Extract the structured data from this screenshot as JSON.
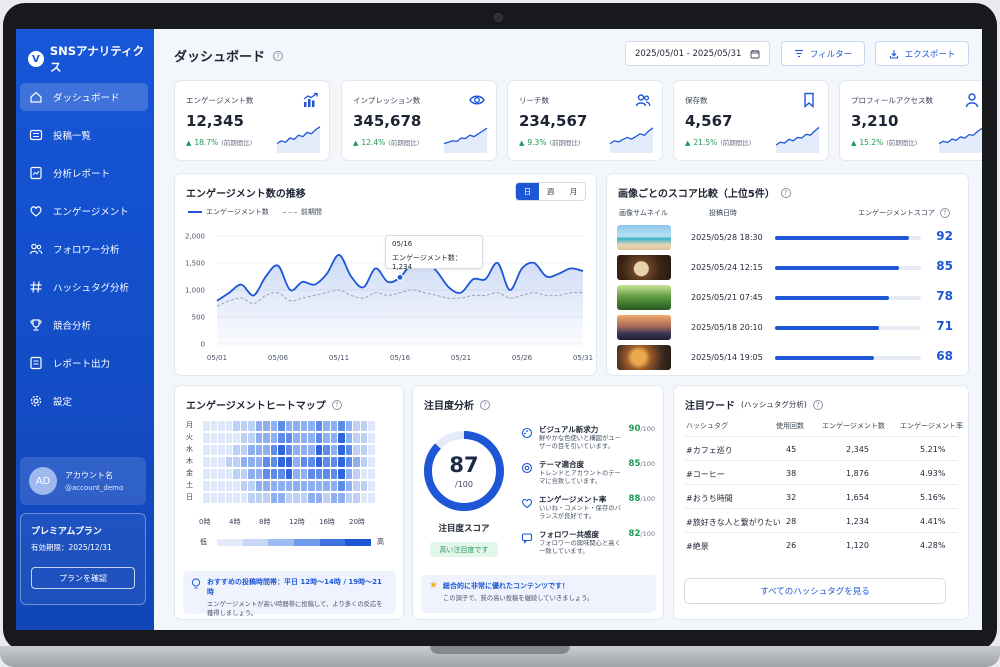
{
  "brand": {
    "logo_letter": "V",
    "name": "SNSアナリティクス"
  },
  "nav": [
    {
      "label": "ダッシュボード",
      "icon": "home-icon"
    },
    {
      "label": "投稿一覧",
      "icon": "list-icon"
    },
    {
      "label": "分析レポート",
      "icon": "report-icon"
    },
    {
      "label": "エンゲージメント",
      "icon": "heart-icon"
    },
    {
      "label": "フォロワー分析",
      "icon": "users-icon"
    },
    {
      "label": "ハッシュタグ分析",
      "icon": "hashtag-icon"
    },
    {
      "label": "競合分析",
      "icon": "trophy-icon"
    },
    {
      "label": "レポート出力",
      "icon": "export-icon"
    },
    {
      "label": "設定",
      "icon": "gear-icon"
    }
  ],
  "account": {
    "initials": "AD",
    "name": "アカウント名",
    "id": "@account_demo"
  },
  "premium": {
    "title": "プレミアムプラン",
    "expiry": "有効期限：2025/12/31",
    "button": "プランを確認"
  },
  "header": {
    "title": "ダッシュボード",
    "date_range": "2025/05/01 - 2025/05/31",
    "filter": "フィルター",
    "export": "エクスポート"
  },
  "kpis": [
    {
      "label": "エンゲージメント数",
      "value": "12,345",
      "change": "18.7%",
      "note": "(前期間比)",
      "icon": "chart-up-icon"
    },
    {
      "label": "インプレッション数",
      "value": "345,678",
      "change": "12.4%",
      "note": "(前期間比)",
      "icon": "eye-icon"
    },
    {
      "label": "リーチ数",
      "value": "234,567",
      "change": "9.3%",
      "note": "(前期間比)",
      "icon": "users-icon"
    },
    {
      "label": "保存数",
      "value": "4,567",
      "change": "21.5%",
      "note": "(前期間比)",
      "icon": "bookmark-icon"
    },
    {
      "label": "プロフィールアクセス数",
      "value": "3,210",
      "change": "15.2%",
      "note": "(前期間比)",
      "icon": "user-icon"
    }
  ],
  "trend": {
    "title": "エンゲージメント数の推移",
    "periods": [
      "日",
      "週",
      "月"
    ],
    "active_period": "日",
    "legend": [
      "エンゲージメント数",
      "前期間"
    ],
    "tooltip_date": "05/16",
    "tooltip_text": "エンゲージメント数：1,234"
  },
  "chart_data": {
    "type": "line",
    "x": [
      "05/01",
      "05/02",
      "05/03",
      "05/04",
      "05/05",
      "05/06",
      "05/07",
      "05/08",
      "05/09",
      "05/10",
      "05/11",
      "05/12",
      "05/13",
      "05/14",
      "05/15",
      "05/16",
      "05/17",
      "05/18",
      "05/19",
      "05/20",
      "05/21",
      "05/22",
      "05/23",
      "05/24",
      "05/25",
      "05/26",
      "05/27",
      "05/28",
      "05/29",
      "05/30",
      "05/31"
    ],
    "x_ticks": [
      "05/01",
      "05/06",
      "05/11",
      "05/16",
      "05/21",
      "05/26",
      "05/31"
    ],
    "series": [
      {
        "name": "エンゲージメント数",
        "values": [
          800,
          950,
          1100,
          900,
          1250,
          1450,
          1000,
          1150,
          1100,
          1300,
          1650,
          1250,
          1050,
          1400,
          1150,
          1234,
          1500,
          1550,
          1350,
          1050,
          950,
          1200,
          1200,
          1500,
          1000,
          1400,
          1500,
          1250,
          1300,
          1400,
          1350
        ],
        "color": "#1d57d6"
      },
      {
        "name": "前期間",
        "values": [
          700,
          800,
          850,
          750,
          900,
          950,
          800,
          850,
          900,
          950,
          1000,
          900,
          850,
          950,
          900,
          950,
          1000,
          950,
          900,
          850,
          850,
          900,
          900,
          950,
          850,
          900,
          950,
          900,
          900,
          950,
          950
        ],
        "color": "#9aa3b5"
      }
    ],
    "yticks": [
      0,
      500,
      1000,
      1500,
      2000
    ],
    "ylim": [
      0,
      2000
    ]
  },
  "score_compare": {
    "title": "画像ごとのスコア比較（上位5件）",
    "col_thumb": "画像サムネイル",
    "col_date": "投稿日時",
    "col_score": "エンゲージメントスコア",
    "rows": [
      {
        "date": "2025/05/28 18:30",
        "score": 92,
        "thumb": "beach"
      },
      {
        "date": "2025/05/24 12:15",
        "score": 85,
        "thumb": "coffee"
      },
      {
        "date": "2025/05/21 07:45",
        "score": 78,
        "thumb": "forest"
      },
      {
        "date": "2025/05/18 20:10",
        "score": 71,
        "thumb": "city"
      },
      {
        "date": "2025/05/14 19:05",
        "score": 68,
        "thumb": "food"
      }
    ]
  },
  "heatmap": {
    "title": "エンゲージメントヒートマップ",
    "days": [
      "月",
      "火",
      "水",
      "木",
      "金",
      "土",
      "日"
    ],
    "hours": [
      "0時",
      "4時",
      "8時",
      "12時",
      "16時",
      "20時"
    ],
    "scale_low": "低",
    "scale_high": "高",
    "tip_title": "おすすめの投稿時間帯：平日 12時〜14時 / 19時〜21時",
    "tip_body": "エンゲージメントが高い時間帯に投稿して、より多くの反応を獲得しましょう。",
    "values": [
      [
        1,
        1,
        1,
        1,
        2,
        2,
        2,
        3,
        3,
        3,
        4,
        3,
        3,
        3,
        3,
        4,
        3,
        3,
        4,
        3,
        2,
        2,
        1
      ],
      [
        1,
        1,
        1,
        1,
        1,
        2,
        2,
        3,
        3,
        3,
        4,
        4,
        3,
        3,
        3,
        4,
        3,
        3,
        5,
        3,
        2,
        2,
        1
      ],
      [
        1,
        1,
        1,
        1,
        2,
        2,
        3,
        3,
        3,
        4,
        5,
        4,
        3,
        3,
        3,
        5,
        4,
        3,
        5,
        4,
        2,
        2,
        1
      ],
      [
        1,
        1,
        1,
        2,
        2,
        3,
        3,
        3,
        4,
        4,
        5,
        5,
        3,
        4,
        4,
        5,
        4,
        4,
        5,
        4,
        3,
        2,
        1
      ],
      [
        1,
        1,
        1,
        1,
        2,
        2,
        3,
        3,
        4,
        4,
        4,
        5,
        3,
        3,
        4,
        4,
        4,
        4,
        5,
        3,
        2,
        1,
        1
      ],
      [
        1,
        1,
        1,
        1,
        1,
        2,
        2,
        3,
        3,
        3,
        3,
        3,
        3,
        3,
        3,
        3,
        3,
        3,
        4,
        3,
        2,
        2,
        1
      ],
      [
        1,
        1,
        1,
        1,
        1,
        1,
        2,
        2,
        2,
        3,
        3,
        2,
        2,
        2,
        3,
        3,
        2,
        3,
        3,
        2,
        2,
        1,
        1
      ]
    ]
  },
  "attention": {
    "title": "注目度分析",
    "score": "87",
    "score_max": "/100",
    "score_fraction": 0.87,
    "score_label": "注目度スコア",
    "badge": "高い注目度です",
    "items": [
      {
        "title": "ビジュアル新求力",
        "desc": "鮮やかな色使いと構図がユーザーの目を引いています。",
        "score": "90",
        "max": "/100",
        "icon": "palette-icon"
      },
      {
        "title": "テーマ適合度",
        "desc": "トレンドとアカウントのテーマに合致しています。",
        "score": "85",
        "max": "/100",
        "icon": "target-icon"
      },
      {
        "title": "エンゲージメント率",
        "desc": "いいね・コメント・保存のバランスが良好です。",
        "score": "88",
        "max": "/100",
        "icon": "heart-icon"
      },
      {
        "title": "フォロワー共感度",
        "desc": "フォロワーの興味関心と高く一致しています。",
        "score": "82",
        "max": "/100",
        "icon": "chat-icon"
      }
    ],
    "note_title": "総合的に非常に優れたコンテンツです！",
    "note_body": "この調子で、質の高い投稿を継続していきましょう。"
  },
  "words": {
    "title": "注目ワード",
    "subtitle": "(ハッシュタグ分析)",
    "cols": [
      "ハッシュタグ",
      "使用回数",
      "エンゲージメント数",
      "エンゲージメント率"
    ],
    "rows": [
      [
        "#カフェ巡り",
        "45",
        "2,345",
        "5.21%"
      ],
      [
        "#コーヒー",
        "38",
        "1,876",
        "4.93%"
      ],
      [
        "#おうち時間",
        "32",
        "1,654",
        "5.16%"
      ],
      [
        "#旅好きな人と繋がりたい",
        "28",
        "1,234",
        "4.41%"
      ],
      [
        "#絶景",
        "26",
        "1,120",
        "4.28%"
      ]
    ],
    "button": "すべてのハッシュタグを見る"
  },
  "colors": {
    "primary": "#1d57d6",
    "sidebar": "#1656d8",
    "positive": "#1e9a55"
  }
}
